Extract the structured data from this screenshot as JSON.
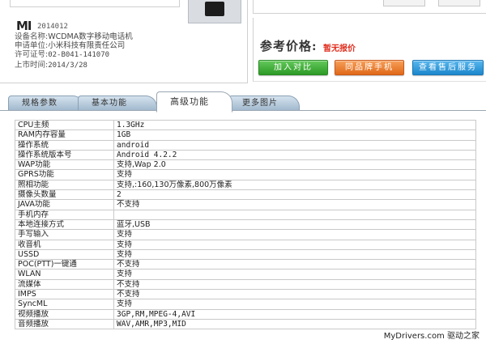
{
  "device": {
    "logo": "MI",
    "model_code": "2014012",
    "specs": [
      {
        "label": "设备名称:",
        "value": "WCDMA数字移动电话机"
      },
      {
        "label": "申请单位:",
        "value": "小米科技有限责任公司"
      },
      {
        "label": "许可证号:",
        "value": "02-B041-141070"
      },
      {
        "label": "上市时间:",
        "value": "2014/3/28"
      }
    ]
  },
  "price": {
    "label": "参考价格:",
    "value": "暂无报价"
  },
  "actions": {
    "add_compare": "加入对比",
    "same_brand": "同品牌手机",
    "after_sales": "查看售后服务"
  },
  "tabs": [
    {
      "label": "规格参数",
      "active": false
    },
    {
      "label": "基本功能",
      "active": false
    },
    {
      "label": "高级功能",
      "active": true
    },
    {
      "label": "更多图片",
      "active": false
    }
  ],
  "table": [
    {
      "key": "CPU主频",
      "value": "1.3GHz"
    },
    {
      "key": "RAM内存容量",
      "value": "1GB"
    },
    {
      "key": "操作系统",
      "value": "android"
    },
    {
      "key": "操作系统版本号",
      "value": "Android 4.2.2"
    },
    {
      "key": "WAP功能",
      "value": "支持,Wap 2.0"
    },
    {
      "key": "GPRS功能",
      "value": "支持"
    },
    {
      "key": "照相功能",
      "value": "支持,:160,130万像素,800万像素"
    },
    {
      "key": "摄像头数量",
      "value": "2"
    },
    {
      "key": "JAVA功能",
      "value": "不支持"
    },
    {
      "key": "手机内存",
      "value": ""
    },
    {
      "key": "本地连接方式",
      "value": "蓝牙,USB"
    },
    {
      "key": "手写输入",
      "value": "支持"
    },
    {
      "key": "收音机",
      "value": "支持"
    },
    {
      "key": "USSD",
      "value": "支持"
    },
    {
      "key": "POC(PTT)一键通",
      "value": "不支持"
    },
    {
      "key": "WLAN",
      "value": "支持"
    },
    {
      "key": "流媒体",
      "value": "不支持"
    },
    {
      "key": "IMPS",
      "value": "不支持"
    },
    {
      "key": "SyncML",
      "value": "支持"
    },
    {
      "key": "视频播放",
      "value": "3GP,RM,MPEG-4,AVI"
    },
    {
      "key": "音频播放",
      "value": "WAV,AMR,MP3,MID"
    }
  ],
  "watermark": {
    "site": "MyDrivers.com",
    "brand": "驱动之家"
  },
  "colors": {
    "price_red": "#e03020",
    "button_green": "#2d9a26",
    "button_orange": "#e06818",
    "button_blue": "#1c87cc",
    "tab_blue": "#9fb7cc"
  }
}
